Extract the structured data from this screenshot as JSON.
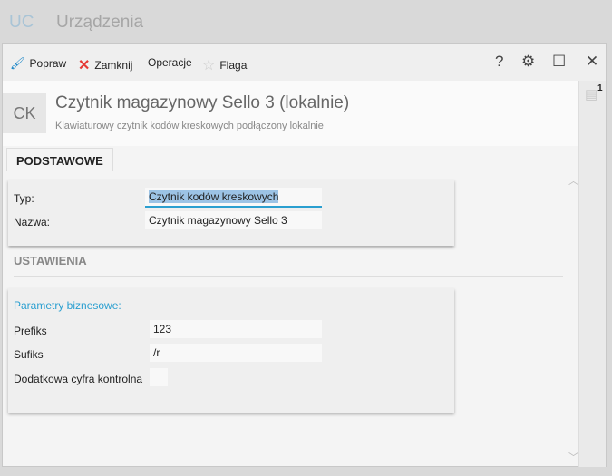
{
  "app": {
    "code": "UC",
    "title": "Urządzenia"
  },
  "toolbar": {
    "edit": "Popraw",
    "close": "Zamknij",
    "operations": "Operacje",
    "flag": "Flaga",
    "help": "?"
  },
  "header": {
    "code": "CK",
    "title": "Czytnik magazynowy Sello 3 (lokalnie)",
    "subtitle": "Klawiaturowy czytnik kodów kreskowych podłączony lokalnie"
  },
  "sidebar": {
    "comments_count": "1"
  },
  "tabs": [
    {
      "label": "PODSTAWOWE",
      "active": true
    }
  ],
  "basic": {
    "type_label": "Typ:",
    "type_value": "Czytnik kodów kreskowych",
    "name_label": "Nazwa:",
    "name_value": "Czytnik magazynowy Sello 3"
  },
  "settings": {
    "section": "USTAWIENIA",
    "group": "Parametry biznesowe:",
    "prefix_label": "Prefiks",
    "prefix_value": "123",
    "suffix_label": "Sufiks",
    "suffix_value": "/r",
    "check_digit_label": "Dodatkowa cyfra kontrolna",
    "check_digit_value": ""
  },
  "colors": {
    "accent": "#2a9fd0",
    "close_red": "#e53935"
  }
}
